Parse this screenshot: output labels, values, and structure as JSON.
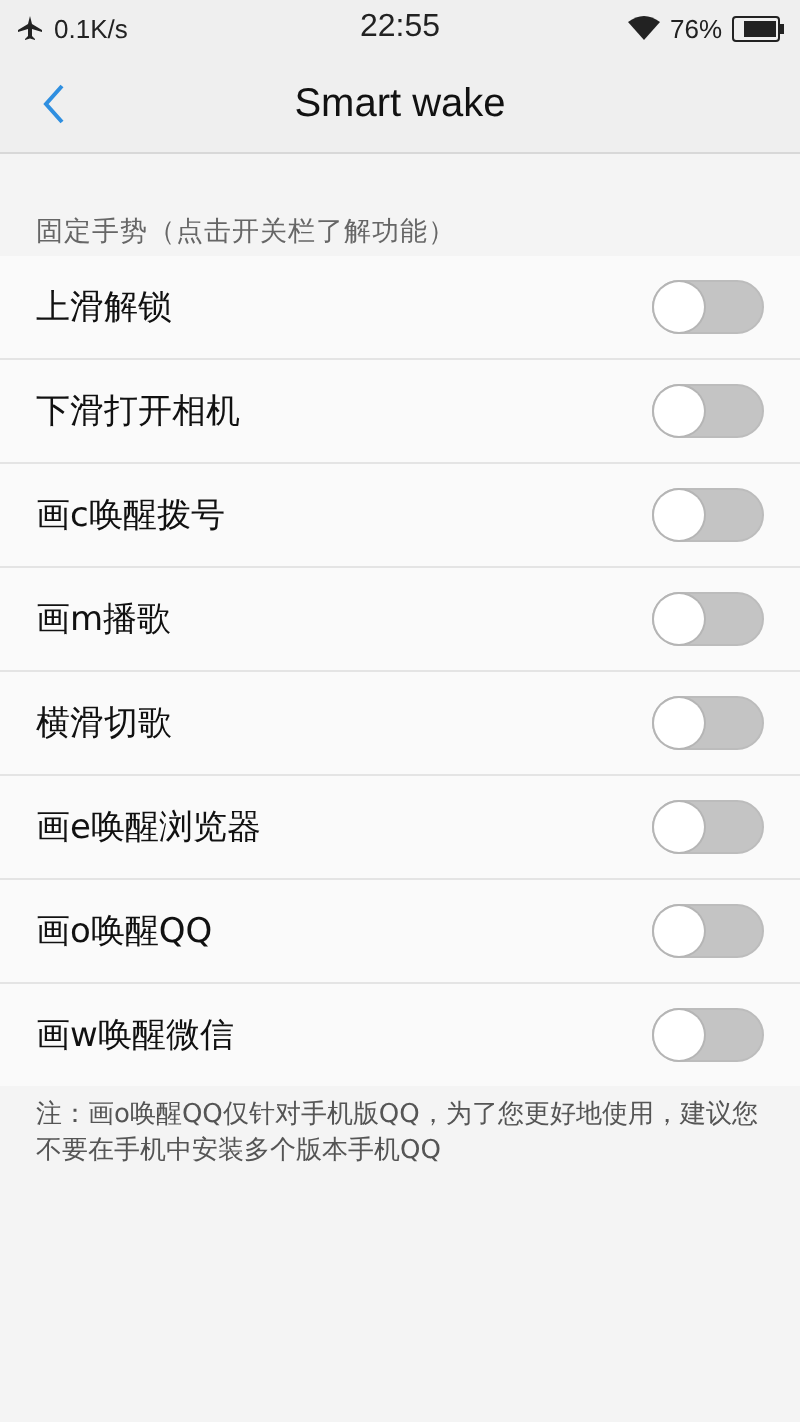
{
  "status_bar": {
    "speed": "0.1K/s",
    "time": "22:55",
    "battery": "76%"
  },
  "header": {
    "title": "Smart wake"
  },
  "section": {
    "label": "固定手势（点击开关栏了解功能）"
  },
  "gestures": [
    {
      "label": "上滑解锁",
      "on": false
    },
    {
      "label": "下滑打开相机",
      "on": false
    },
    {
      "label": "画c唤醒拨号",
      "on": false
    },
    {
      "label": "画m播歌",
      "on": false
    },
    {
      "label": "横滑切歌",
      "on": false
    },
    {
      "label": "画e唤醒浏览器",
      "on": false
    },
    {
      "label": "画o唤醒QQ",
      "on": false
    },
    {
      "label": "画w唤醒微信",
      "on": false
    }
  ],
  "note": "注：画o唤醒QQ仅针对手机版QQ，为了您更好地使用，建议您不要在手机中安装多个版本手机QQ"
}
